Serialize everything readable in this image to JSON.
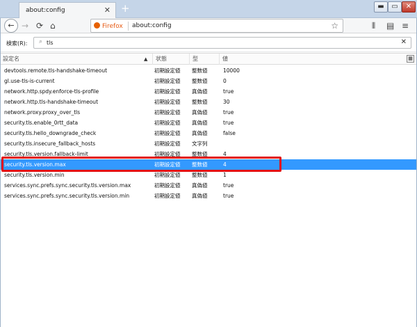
{
  "tab": {
    "title": "about:config"
  },
  "toolbar": {
    "identity_label": "Firefox",
    "url": "about:config"
  },
  "search": {
    "label": "検索(R):",
    "value": "tls"
  },
  "columns": {
    "name": "設定名",
    "status": "状態",
    "type": "型",
    "value": "値"
  },
  "rows": [
    {
      "name": "devtools.remote.tls-handshake-timeout",
      "status": "初期設定値",
      "type": "整数値",
      "value": "10000"
    },
    {
      "name": "gl.use-tls-is-current",
      "status": "初期設定値",
      "type": "整数値",
      "value": "0"
    },
    {
      "name": "network.http.spdy.enforce-tls-profile",
      "status": "初期設定値",
      "type": "真偽値",
      "value": "true"
    },
    {
      "name": "network.http.tls-handshake-timeout",
      "status": "初期設定値",
      "type": "整数値",
      "value": "30"
    },
    {
      "name": "network.proxy.proxy_over_tls",
      "status": "初期設定値",
      "type": "真偽値",
      "value": "true"
    },
    {
      "name": "security.tls.enable_0rtt_data",
      "status": "初期設定値",
      "type": "真偽値",
      "value": "true"
    },
    {
      "name": "security.tls.hello_downgrade_check",
      "status": "初期設定値",
      "type": "真偽値",
      "value": "false"
    },
    {
      "name": "security.tls.insecure_fallback_hosts",
      "status": "初期設定値",
      "type": "文字列",
      "value": ""
    },
    {
      "name": "security.tls.version.fallback-limit",
      "status": "初期設定値",
      "type": "整数値",
      "value": "4"
    },
    {
      "name": "security.tls.version.max",
      "status": "初期設定値",
      "type": "整数値",
      "value": "4",
      "selected": true
    },
    {
      "name": "security.tls.version.min",
      "status": "初期設定値",
      "type": "整数値",
      "value": "1"
    },
    {
      "name": "services.sync.prefs.sync.security.tls.version.max",
      "status": "初期設定値",
      "type": "真偽値",
      "value": "true"
    },
    {
      "name": "services.sync.prefs.sync.security.tls.version.min",
      "status": "初期設定値",
      "type": "真偽値",
      "value": "true"
    }
  ],
  "icons": {
    "back": "back-arrow-icon",
    "forward": "forward-arrow-icon",
    "reload": "reload-icon",
    "home": "home-icon",
    "bookmark": "star-icon",
    "library": "library-icon",
    "sidebar": "sidebar-icon",
    "menu": "hamburger-menu-icon",
    "search": "magnifier-icon",
    "clear": "clear-icon"
  },
  "colors": {
    "selected_row": "#3399ff",
    "highlight_box": "#e31010",
    "firefox_orange": "#e66000"
  }
}
